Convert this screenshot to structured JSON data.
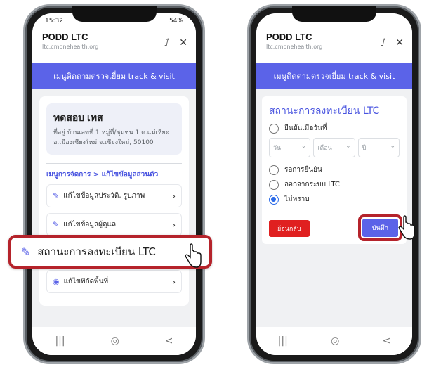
{
  "phone1": {
    "status_time": "15:32",
    "status_battery": "54%",
    "app_title": "PODD LTC",
    "app_url": "ltc.cmonehealth.org",
    "banner": "เมนูติดตามตรวจเยี่ยม track & visit",
    "profile_name": "ทดสอบ เทส",
    "profile_address_1": "ที่อยู่ บ้านเลขที่ 1 หมู่ที่/ชุมชน 1 ต.แม่เหียะ",
    "profile_address_2": "อ.เมืองเชียงใหม่ จ.เชียงใหม่, 50100",
    "menu_heading": "เมนูการจัดการ > แก้ไขข้อมูลส่วนตัว",
    "menu_items": [
      "แก้ไขข้อมูลประวัติ, รูปภาพ",
      "แก้ไขข้อมูลผู้ดูแล",
      "แก้ไขพิกัดพื้นที่"
    ],
    "highlight_item": "สถานะการลงทะเบียน LTC"
  },
  "phone2": {
    "app_title": "PODD LTC",
    "app_url": "ltc.cmonehealth.org",
    "banner": "เมนูติดตามตรวจเยี่ยม track & visit",
    "form_title": "สถานะการลงทะเบียน LTC",
    "option_confirm_date": "ยืนยันเมื่อวันที่",
    "select_day": "วัน",
    "select_month": "เดือน",
    "select_year": "ปี",
    "option_pending": "รอการยืนยัน",
    "option_exit": "ออกจากระบบ LTC",
    "option_unknown": "ไม่ทราบ",
    "btn_back": "ย้อนกลับ",
    "btn_save": "บันทึก"
  },
  "icons": {
    "share": "share-icon",
    "close": "close-icon",
    "edit": "edit-icon",
    "location": "location-pin-icon",
    "chevron": "chevron-right-icon"
  },
  "colors": {
    "accent": "#5b63e8",
    "highlight_border": "#b5232b",
    "back_button": "#e02020"
  }
}
